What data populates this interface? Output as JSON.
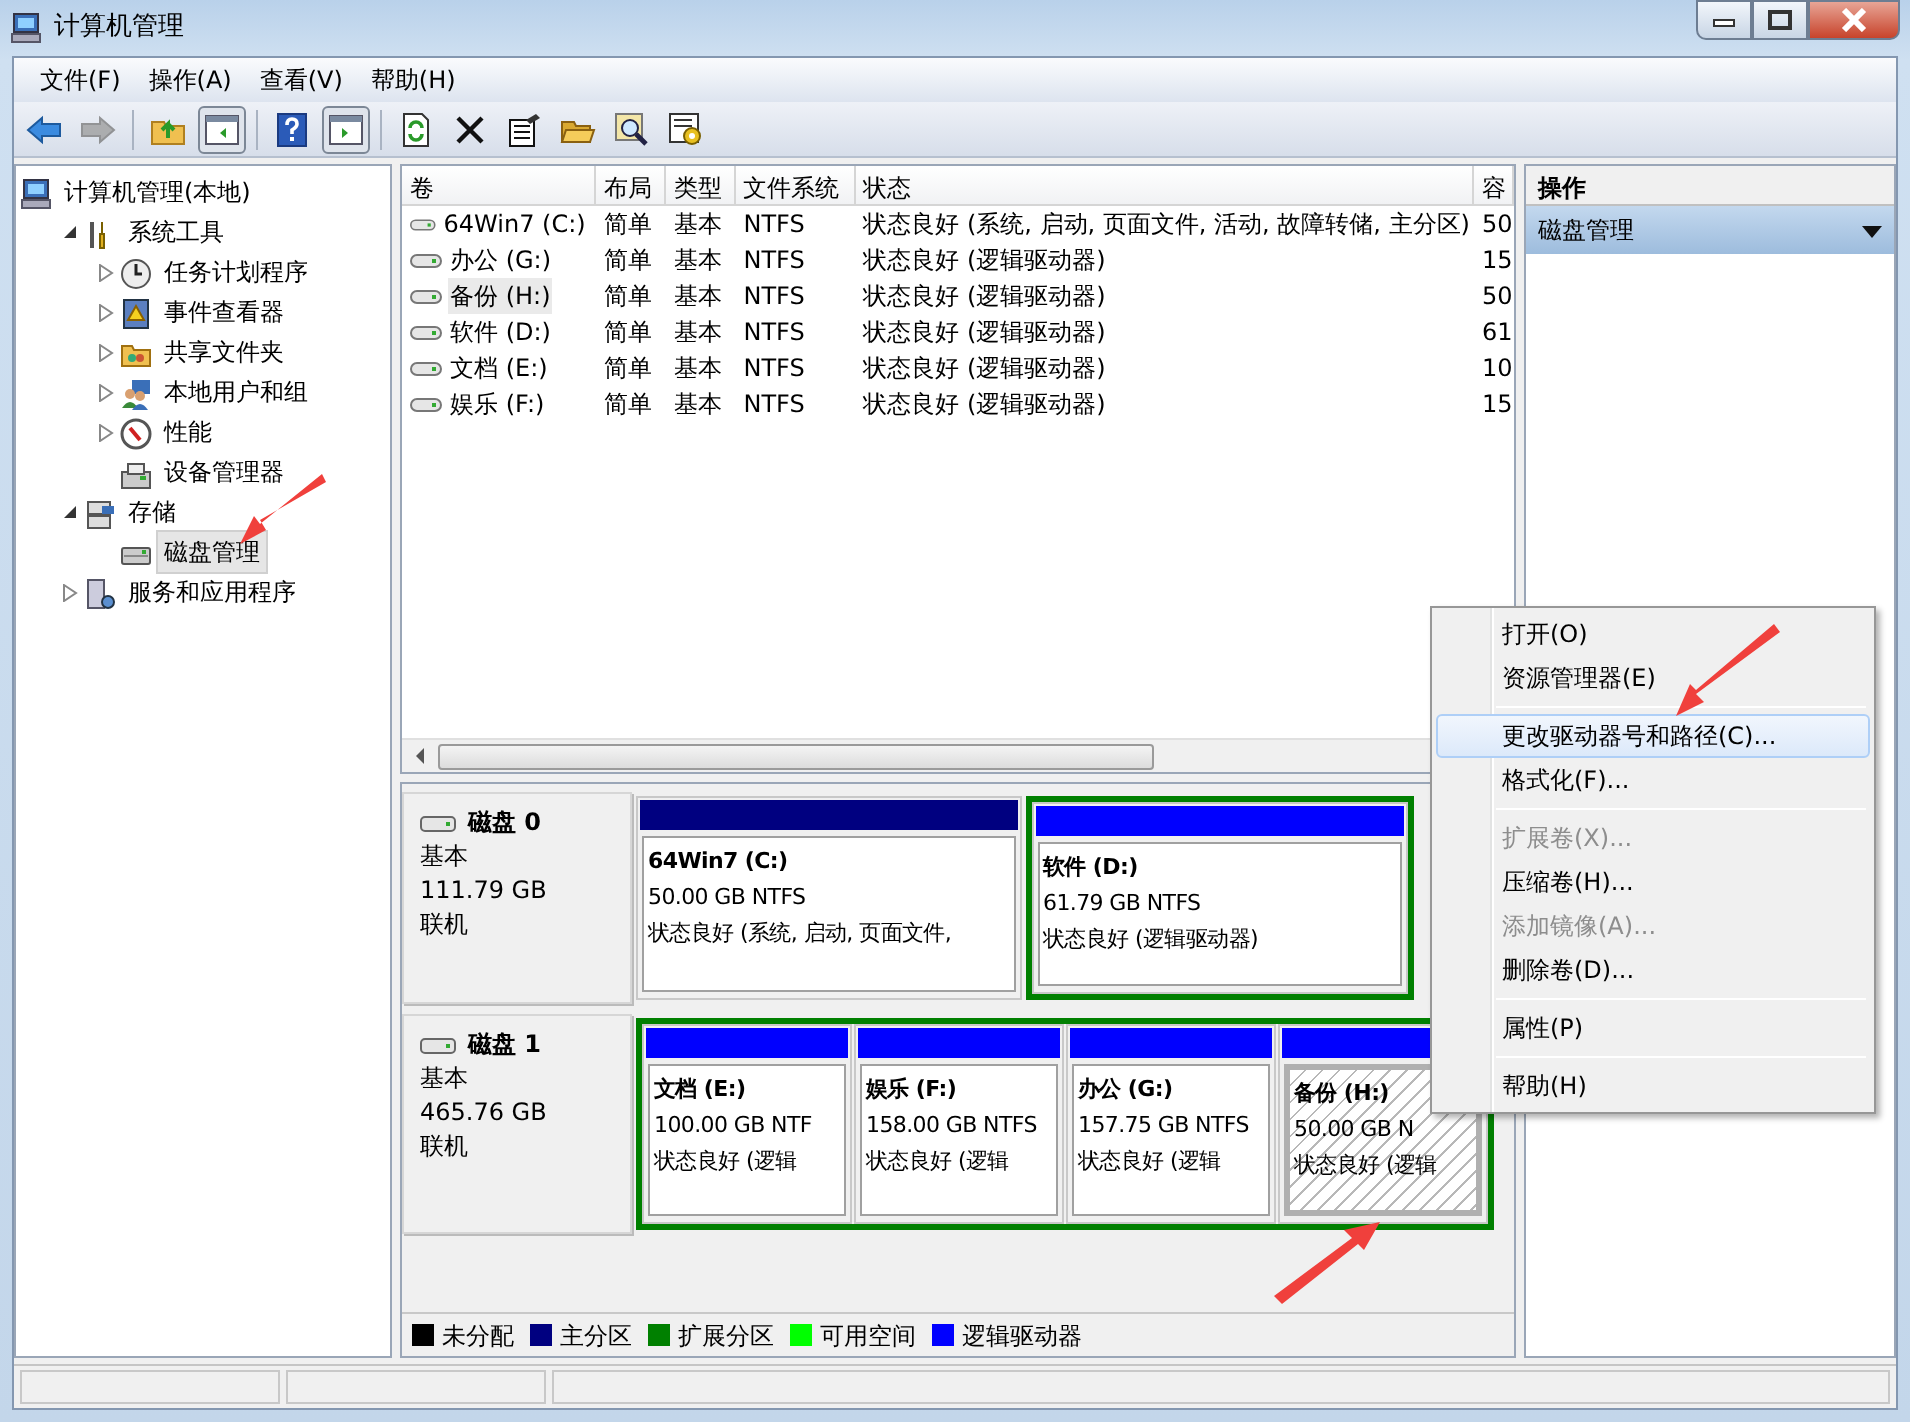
{
  "window": {
    "title": "计算机管理"
  },
  "menu": [
    "文件(F)",
    "操作(A)",
    "查看(V)",
    "帮助(H)"
  ],
  "toolbar": [
    {
      "kind": "back",
      "disabled": false,
      "pressed": false
    },
    {
      "kind": "forward",
      "disabled": true,
      "pressed": false
    },
    {
      "kind": "separator"
    },
    {
      "kind": "up",
      "disabled": false,
      "pressed": false
    },
    {
      "kind": "tree-pane",
      "disabled": false,
      "pressed": true
    },
    {
      "kind": "separator"
    },
    {
      "kind": "help",
      "disabled": false,
      "pressed": false
    },
    {
      "kind": "action-pane",
      "disabled": false,
      "pressed": true
    },
    {
      "kind": "separator"
    },
    {
      "kind": "refresh",
      "disabled": false,
      "pressed": false
    },
    {
      "kind": "delete",
      "disabled": false,
      "pressed": false
    },
    {
      "kind": "properties",
      "disabled": false,
      "pressed": false
    },
    {
      "kind": "open",
      "disabled": false,
      "pressed": false
    },
    {
      "kind": "find",
      "disabled": false,
      "pressed": false
    },
    {
      "kind": "settings",
      "disabled": false,
      "pressed": false
    }
  ],
  "tree": [
    {
      "label": "计算机管理(本地)",
      "kind": "computer",
      "selected": false,
      "children": [
        {
          "label": "系统工具",
          "kind": "tools",
          "expanded": true,
          "selected": false,
          "children": [
            {
              "label": "任务计划程序",
              "kind": "clock",
              "expanded": false,
              "selected": false
            },
            {
              "label": "事件查看器",
              "kind": "log",
              "expanded": false,
              "selected": false
            },
            {
              "label": "共享文件夹",
              "kind": "share",
              "expanded": false,
              "selected": false
            },
            {
              "label": "本地用户和组",
              "kind": "users",
              "expanded": false,
              "selected": false
            },
            {
              "label": "性能",
              "kind": "gauge",
              "expanded": false,
              "selected": false
            },
            {
              "label": "设备管理器",
              "kind": "device",
              "selected": false
            }
          ]
        },
        {
          "label": "存储",
          "kind": "storage",
          "expanded": true,
          "selected": false,
          "children": [
            {
              "label": "磁盘管理",
              "kind": "disk",
              "selected": true
            }
          ]
        },
        {
          "label": "服务和应用程序",
          "kind": "services",
          "expanded": false,
          "selected": false
        }
      ]
    }
  ],
  "table": {
    "columns": [
      "卷",
      "布局",
      "类型",
      "文件系统",
      "状态",
      "容"
    ],
    "rows": [
      {
        "cells": [
          "64Win7  (C:)",
          "简单",
          "基本",
          "NTFS",
          "状态良好 (系统, 启动, 页面文件, 活动, 故障转储, 主分区)",
          "50"
        ],
        "selected": false
      },
      {
        "cells": [
          "办公 (G:)",
          "简单",
          "基本",
          "NTFS",
          "状态良好 (逻辑驱动器)",
          "15"
        ],
        "selected": false
      },
      {
        "cells": [
          "备份 (H:)",
          "简单",
          "基本",
          "NTFS",
          "状态良好 (逻辑驱动器)",
          "50"
        ],
        "selected": true
      },
      {
        "cells": [
          "软件 (D:)",
          "简单",
          "基本",
          "NTFS",
          "状态良好 (逻辑驱动器)",
          "61"
        ],
        "selected": false
      },
      {
        "cells": [
          "文档 (E:)",
          "简单",
          "基本",
          "NTFS",
          "状态良好 (逻辑驱动器)",
          "10"
        ],
        "selected": false
      },
      {
        "cells": [
          "娱乐 (F:)",
          "简单",
          "基本",
          "NTFS",
          "状态良好 (逻辑驱动器)",
          "15"
        ],
        "selected": false
      }
    ]
  },
  "disks": [
    {
      "name": "磁盘 0",
      "type": "基本",
      "size": "111.79 GB",
      "state": "联机",
      "segments": [
        {
          "kind": "primary",
          "label": "64Win7    (C:)",
          "size": "50.00 GB NTFS",
          "status": "状态良好 (系统, 启动, 页面文件,",
          "selected": false
        },
        {
          "kind": "extended",
          "partitions": [
            {
              "kind": "logical",
              "label": "软件  (D:)",
              "size": "61.79 GB NTFS",
              "status": "状态良好 (逻辑驱动器)",
              "selected": false
            }
          ]
        }
      ]
    },
    {
      "name": "磁盘 1",
      "type": "基本",
      "size": "465.76 GB",
      "state": "联机",
      "segments": [
        {
          "kind": "extended",
          "partitions": [
            {
              "kind": "logical",
              "label": "文档  (E:)",
              "size": "100.00 GB NTF",
              "status": "状态良好 (逻辑",
              "selected": false
            },
            {
              "kind": "logical",
              "label": "娱乐  (F:)",
              "size": "158.00 GB NTFS",
              "status": "状态良好 (逻辑",
              "selected": false
            },
            {
              "kind": "logical",
              "label": "办公  (G:)",
              "size": "157.75 GB NTFS",
              "status": "状态良好 (逻辑",
              "selected": false
            },
            {
              "kind": "logical",
              "label": "备份  (H:)",
              "size": "50.00 GB N",
              "status": "状态良好 (逻辑",
              "selected": true
            }
          ]
        }
      ]
    }
  ],
  "legend": [
    {
      "label": "未分配",
      "color": "#000000"
    },
    {
      "label": "主分区",
      "color": "#000080"
    },
    {
      "label": "扩展分区",
      "color": "#008000"
    },
    {
      "label": "可用空间",
      "color": "#00ff00"
    },
    {
      "label": "逻辑驱动器",
      "color": "#0000ff"
    }
  ],
  "actions": {
    "title": "操作",
    "items": [
      {
        "label": "磁盘管理",
        "selected": true
      }
    ]
  },
  "context_menu": [
    {
      "kind": "item",
      "label": "打开(O)",
      "disabled": false,
      "selected": false
    },
    {
      "kind": "item",
      "label": "资源管理器(E)",
      "disabled": false,
      "selected": false
    },
    {
      "kind": "separator"
    },
    {
      "kind": "item",
      "label": "更改驱动器号和路径(C)...",
      "disabled": false,
      "selected": true
    },
    {
      "kind": "item",
      "label": "格式化(F)...",
      "disabled": false,
      "selected": false
    },
    {
      "kind": "separator"
    },
    {
      "kind": "item",
      "label": "扩展卷(X)...",
      "disabled": true,
      "selected": false
    },
    {
      "kind": "item",
      "label": "压缩卷(H)...",
      "disabled": false,
      "selected": false
    },
    {
      "kind": "item",
      "label": "添加镜像(A)...",
      "disabled": true,
      "selected": false
    },
    {
      "kind": "item",
      "label": "删除卷(D)...",
      "disabled": false,
      "selected": false
    },
    {
      "kind": "separator"
    },
    {
      "kind": "item",
      "label": "属性(P)",
      "disabled": false,
      "selected": false
    },
    {
      "kind": "separator"
    },
    {
      "kind": "item",
      "label": "帮助(H)",
      "disabled": false,
      "selected": false
    }
  ]
}
